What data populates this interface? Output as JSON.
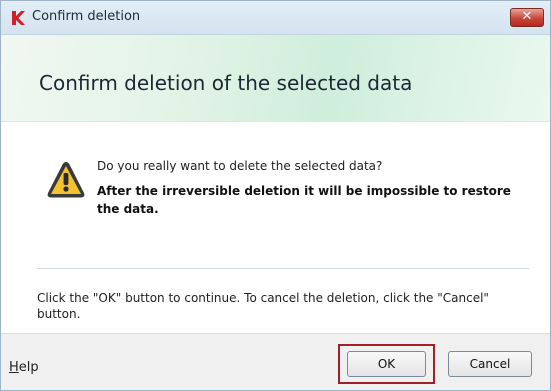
{
  "window": {
    "title": "Confirm deletion",
    "close_glyph": "✕"
  },
  "header": {
    "title": "Confirm deletion of the selected data"
  },
  "body": {
    "question": "Do you really want to delete the selected data?",
    "warning": "After the irreversible deletion it will be impossible to restore the data.",
    "instructions": "Click the \"OK\" button to continue. To cancel the deletion, click the \"Cancel\" button."
  },
  "footer": {
    "help_first": "H",
    "help_rest": "elp",
    "ok_label": "OK",
    "cancel_label": "Cancel"
  },
  "icons": {
    "app": "kaspersky-logo-icon",
    "warning": "warning-triangle-icon",
    "close": "close-icon"
  },
  "colors": {
    "close_button": "#c9463a",
    "ok_highlight": "#a32028",
    "warning_yellow": "#f2c230"
  }
}
